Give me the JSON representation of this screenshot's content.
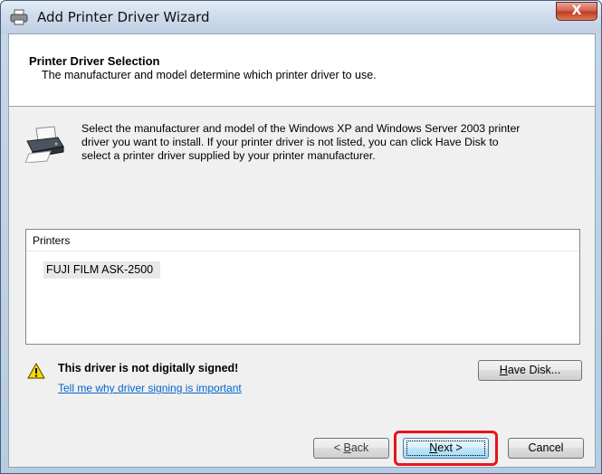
{
  "window": {
    "title": "Add Printer Driver Wizard",
    "close_glyph": "X"
  },
  "header": {
    "title": "Printer Driver Selection",
    "subtitle": "The manufacturer and model determine which printer driver to use."
  },
  "intro": {
    "icon": "printer-icon",
    "line1": "Select the manufacturer and model of the Windows XP and Windows Server 2003 printer",
    "line2": "driver you want to install.  If your printer driver is not listed, you can click Have Disk to",
    "line3": "select a printer driver supplied by your printer manufacturer."
  },
  "printers_list": {
    "header": "Printers",
    "items": [
      "FUJI FILM ASK-2500"
    ],
    "selected_index": 0
  },
  "warning": {
    "icon": "warning-icon",
    "text": "This driver is not digitally signed!",
    "link": "Tell me why driver signing is important"
  },
  "buttons": {
    "have_disk": {
      "accel": "H",
      "rest": "ave Disk..."
    },
    "back": {
      "prefix": "< ",
      "accel": "B",
      "rest": "ack"
    },
    "next": {
      "accel": "N",
      "rest": "ext >"
    },
    "cancel": "Cancel"
  },
  "colors": {
    "highlight": "#e5151b",
    "link": "#0066cc"
  }
}
